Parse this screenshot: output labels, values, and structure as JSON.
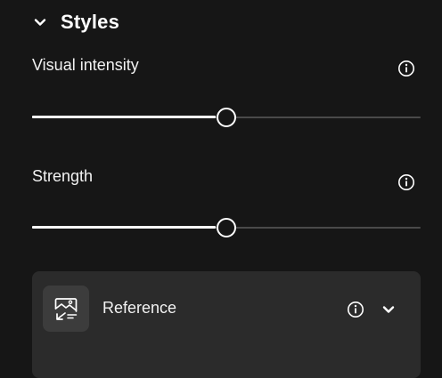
{
  "section": {
    "title": "Styles",
    "expanded": true
  },
  "sliders": [
    {
      "label": "Visual intensity",
      "value_percent": 50,
      "info_icon": "info-icon"
    },
    {
      "label": "Strength",
      "value_percent": 50,
      "info_icon": "info-icon"
    }
  ],
  "reference": {
    "label": "Reference",
    "thumb_icon": "image-reference-icon",
    "info_icon": "info-icon",
    "expand_icon": "chevron-down-icon"
  },
  "colors": {
    "background": "#161616",
    "card": "#2b2b2b",
    "thumb_bg": "#3c3c3c",
    "track": "#4a4a4a",
    "foreground": "#ffffff"
  }
}
